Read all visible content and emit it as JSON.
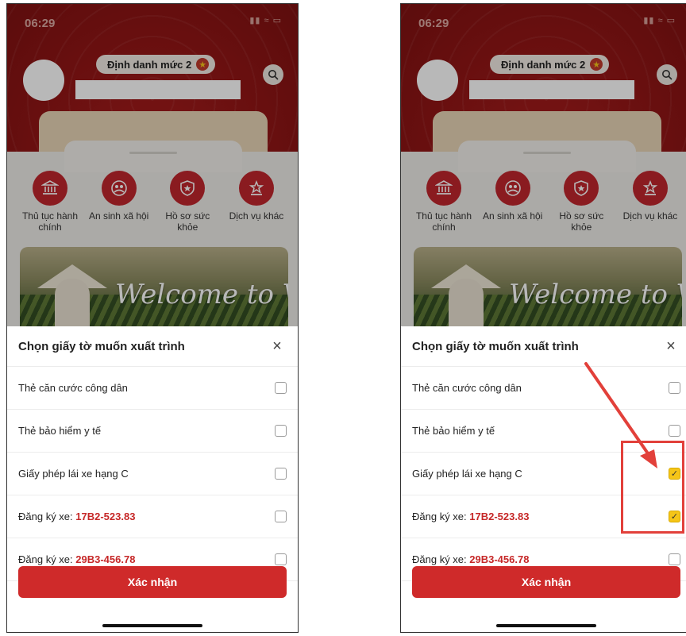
{
  "status": {
    "time": "06:29",
    "icons": "▮▮ ≈ ▭"
  },
  "header": {
    "level_label": "Định danh mức 2"
  },
  "services": [
    {
      "label": "Thủ tục hành chính",
      "icon": "courthouse-icon"
    },
    {
      "label": "An sinh xã hội",
      "icon": "people-icon"
    },
    {
      "label": "Hồ sơ sức khỏe",
      "icon": "health-shield-icon"
    },
    {
      "label": "Dịch vụ khác",
      "icon": "services-icon"
    }
  ],
  "banner": {
    "text": "Welcome to VietN"
  },
  "modal": {
    "title": "Chọn giấy tờ muốn xuất trình",
    "close": "×",
    "confirm_label": "Xác nhận",
    "items": [
      {
        "text": "Thẻ căn cước công dân",
        "plate": ""
      },
      {
        "text": "Thẻ bảo hiểm y tế",
        "plate": ""
      },
      {
        "text": "Giấy phép lái xe hạng C",
        "plate": ""
      },
      {
        "text": "Đăng ký xe: ",
        "plate": "17B2-523.83"
      },
      {
        "text": "Đăng ký xe: ",
        "plate": "29B3-456.78"
      }
    ]
  },
  "screens": [
    {
      "checked": [
        false,
        false,
        false,
        false,
        false
      ]
    },
    {
      "checked": [
        false,
        false,
        true,
        true,
        false
      ]
    }
  ],
  "annotation": {
    "color": "#e2403a"
  },
  "colors": {
    "brand_red": "#c0262d",
    "check_yellow": "#f5c518"
  }
}
